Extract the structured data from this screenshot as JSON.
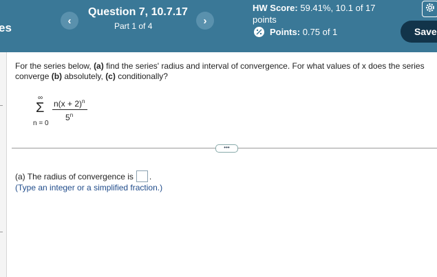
{
  "header": {
    "left_label": "es",
    "question_title": "Question 7, 10.7.17",
    "question_part": "Part 1 of 4",
    "hw_score_label": "HW Score:",
    "hw_score_value": "59.41%, 10.1 of 17 points",
    "points_label": "Points:",
    "points_value": "0.75 of 1",
    "save_label": "Save",
    "prev_glyph": "‹",
    "next_glyph": "›"
  },
  "question": {
    "pre": "For the series below, ",
    "a_label": "(a)",
    "a_text": " find the series' radius and interval of convergence. For what values of x does the series converge ",
    "b_label": "(b)",
    "b_text": " absolutely, ",
    "c_label": "(c)",
    "c_text": " conditionally?"
  },
  "series": {
    "upper": "∞",
    "sigma": "Σ",
    "lower": "n = 0",
    "numerator": "n(x + 2)",
    "numerator_exp": "n",
    "denominator": "5",
    "denominator_exp": "n"
  },
  "answer": {
    "label": "(a) The radius of convergence is",
    "dot": ".",
    "hint": "(Type an integer or a simplified fraction.)"
  },
  "divider": {
    "dots": "•••"
  },
  "icons": {
    "settings": "gear-icon",
    "points": "partial-credit-icon"
  },
  "colors": {
    "header_bg": "#3a7897",
    "save_bg": "#12344a",
    "hint": "#1f4b8a"
  }
}
